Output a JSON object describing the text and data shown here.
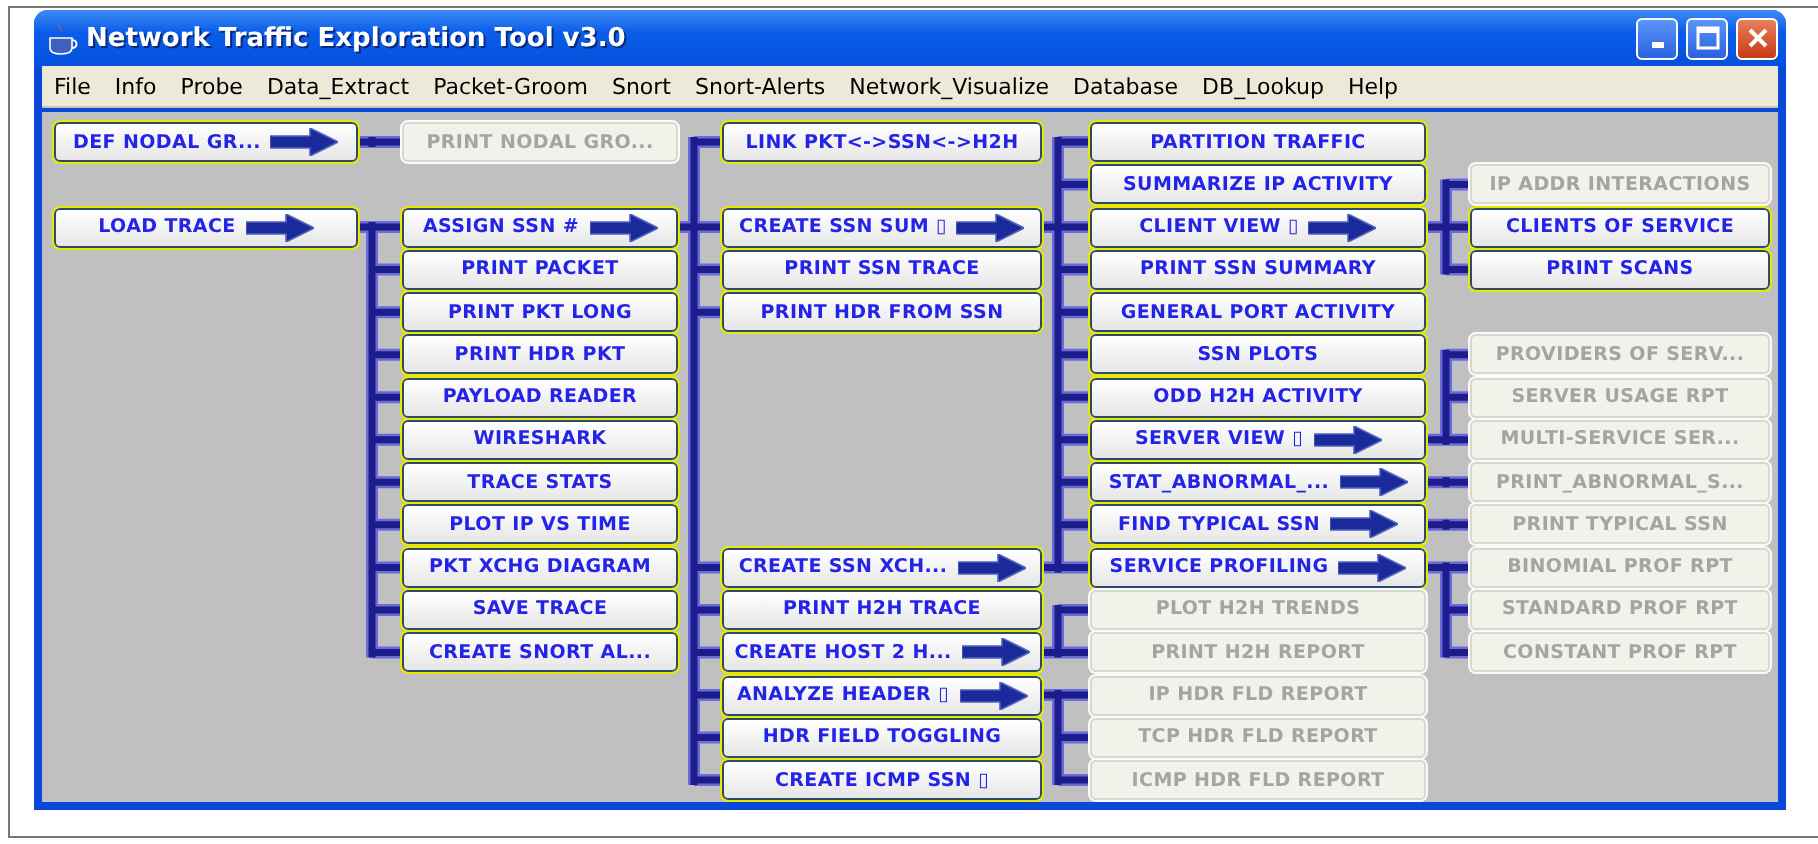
{
  "window": {
    "title": "Network Traffic Exploration Tool v3.0"
  },
  "menu": [
    "File",
    "Info",
    "Probe",
    "Data_Extract",
    "Packet-Groom",
    "Snort",
    "Snort-Alerts",
    "Network_Visualize",
    "Database",
    "DB_Lookup",
    "Help"
  ],
  "columns": [
    [
      {
        "label": "DEF NODAL GR...",
        "kind": "enabled",
        "arrow": true
      },
      {
        "label": "LOAD TRACE",
        "kind": "enabled",
        "arrow": true
      }
    ],
    [
      {
        "label": "PRINT NODAL GRO...",
        "kind": "disabled",
        "arrow": false
      },
      {
        "label": "ASSIGN SSN #",
        "kind": "enabled",
        "arrow": true
      },
      {
        "label": "PRINT PACKET",
        "kind": "enabled",
        "arrow": false
      },
      {
        "label": "PRINT PKT LONG",
        "kind": "enabled",
        "arrow": false
      },
      {
        "label": "PRINT HDR PKT",
        "kind": "enabled",
        "arrow": false
      },
      {
        "label": "PAYLOAD READER",
        "kind": "enabled",
        "arrow": false
      },
      {
        "label": "WIRESHARK",
        "kind": "enabled",
        "arrow": false
      },
      {
        "label": "TRACE STATS",
        "kind": "enabled",
        "arrow": false
      },
      {
        "label": "PLOT IP VS TIME",
        "kind": "enabled",
        "arrow": false
      },
      {
        "label": "PKT XCHG DIAGRAM",
        "kind": "enabled",
        "arrow": false
      },
      {
        "label": "SAVE TRACE",
        "kind": "enabled",
        "arrow": false
      },
      {
        "label": "CREATE SNORT AL...",
        "kind": "enabled",
        "arrow": false
      }
    ],
    [
      {
        "label": "LINK PKT<->SSN<->H2H",
        "kind": "enabled",
        "arrow": false
      },
      {
        "label": "CREATE SSN SUM ▯",
        "kind": "enabled",
        "arrow": true
      },
      {
        "label": "PRINT SSN TRACE",
        "kind": "enabled",
        "arrow": false
      },
      {
        "label": "PRINT HDR FROM SSN",
        "kind": "enabled",
        "arrow": false
      },
      {
        "label": "CREATE SSN XCH...",
        "kind": "enabled",
        "arrow": true
      },
      {
        "label": "PRINT H2H TRACE",
        "kind": "enabled",
        "arrow": false
      },
      {
        "label": "CREATE HOST 2 H...",
        "kind": "enabled",
        "arrow": true
      },
      {
        "label": "ANALYZE HEADER ▯",
        "kind": "enabled",
        "arrow": true
      },
      {
        "label": "HDR FIELD TOGGLING",
        "kind": "enabled",
        "arrow": false
      },
      {
        "label": "CREATE ICMP SSN ▯",
        "kind": "enabled",
        "arrow": false
      }
    ],
    [
      {
        "label": "PARTITION TRAFFIC",
        "kind": "enabled",
        "arrow": false
      },
      {
        "label": "SUMMARIZE IP ACTIVITY",
        "kind": "enabled",
        "arrow": false
      },
      {
        "label": "CLIENT VIEW ▯",
        "kind": "enabled",
        "arrow": true
      },
      {
        "label": "PRINT SSN SUMMARY",
        "kind": "enabled",
        "arrow": false
      },
      {
        "label": "GENERAL PORT ACTIVITY",
        "kind": "enabled",
        "arrow": false
      },
      {
        "label": "SSN PLOTS",
        "kind": "enabled",
        "arrow": false
      },
      {
        "label": "ODD H2H ACTIVITY",
        "kind": "enabled",
        "arrow": false
      },
      {
        "label": "SERVER VIEW ▯",
        "kind": "enabled",
        "arrow": true
      },
      {
        "label": "STAT_ABNORMAL_...",
        "kind": "enabled",
        "arrow": true
      },
      {
        "label": "FIND TYPICAL SSN",
        "kind": "enabled",
        "arrow": true
      },
      {
        "label": "SERVICE PROFILING",
        "kind": "enabled",
        "arrow": true
      },
      {
        "label": "PLOT H2H TRENDS",
        "kind": "disabled",
        "arrow": false
      },
      {
        "label": "PRINT H2H REPORT",
        "kind": "disabled",
        "arrow": false
      },
      {
        "label": "IP HDR FLD REPORT",
        "kind": "disabled",
        "arrow": false
      },
      {
        "label": "TCP HDR FLD REPORT",
        "kind": "disabled",
        "arrow": false
      },
      {
        "label": "ICMP HDR FLD REPORT",
        "kind": "disabled",
        "arrow": false
      }
    ],
    [
      {
        "label": "IP ADDR INTERACTIONS",
        "kind": "disabled",
        "arrow": false
      },
      {
        "label": "CLIENTS OF SERVICE",
        "kind": "enabled",
        "arrow": false
      },
      {
        "label": "PRINT SCANS",
        "kind": "enabled",
        "arrow": false
      },
      {
        "label": "PROVIDERS OF SERV...",
        "kind": "disabled",
        "arrow": false
      },
      {
        "label": "SERVER USAGE RPT",
        "kind": "disabled",
        "arrow": false
      },
      {
        "label": "MULTI-SERVICE SER...",
        "kind": "disabled",
        "arrow": false
      },
      {
        "label": "PRINT_ABNORMAL_S...",
        "kind": "disabled",
        "arrow": false
      },
      {
        "label": "PRINT TYPICAL SSN",
        "kind": "disabled",
        "arrow": false
      },
      {
        "label": "BINOMIAL PROF RPT",
        "kind": "disabled",
        "arrow": false
      },
      {
        "label": "STANDARD PROF RPT",
        "kind": "disabled",
        "arrow": false
      },
      {
        "label": "CONSTANT PROF RPT",
        "kind": "disabled",
        "arrow": false
      }
    ]
  ]
}
